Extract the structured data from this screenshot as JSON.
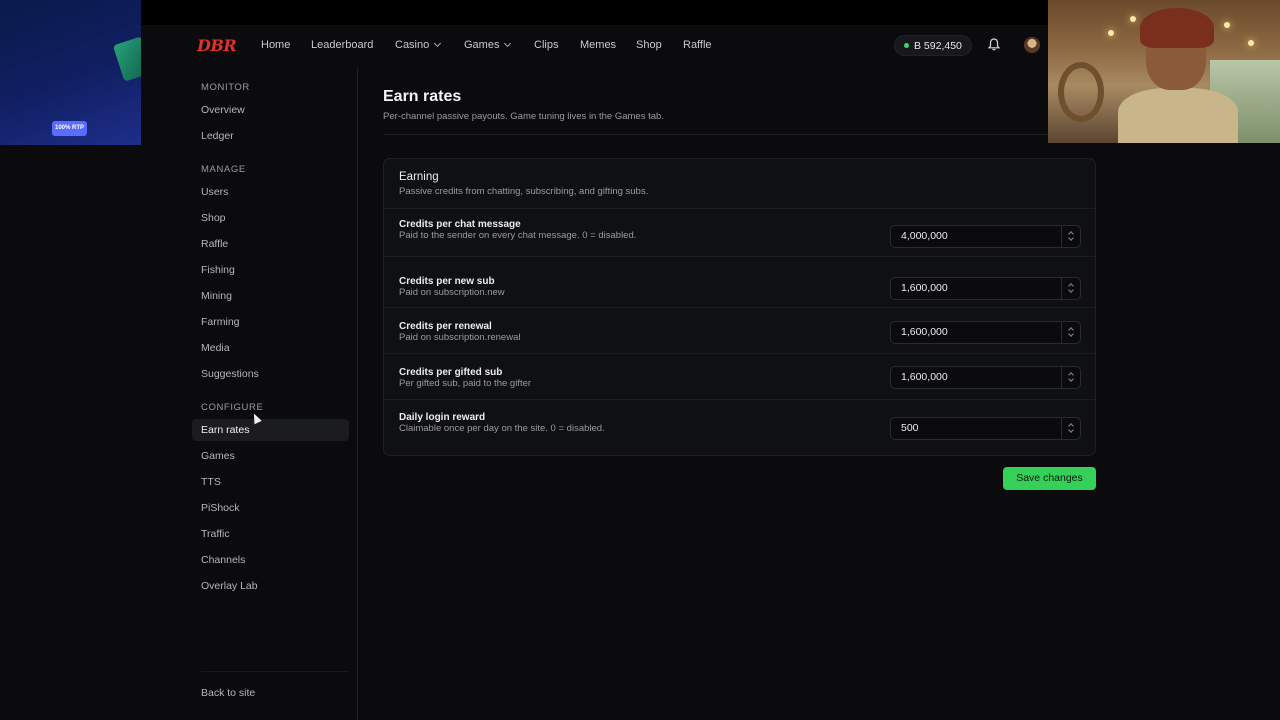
{
  "promo": {
    "badge": "100% RTP"
  },
  "nav": {
    "logo": "DBR",
    "items": [
      {
        "label": "Home"
      },
      {
        "label": "Leaderboard"
      },
      {
        "label": "Casino"
      },
      {
        "label": "Games"
      },
      {
        "label": "Clips"
      },
      {
        "label": "Memes"
      },
      {
        "label": "Shop"
      },
      {
        "label": "Raffle"
      }
    ],
    "balance": "B 592,450",
    "accent": "#e0312b"
  },
  "sidebar": {
    "monitor_label": "MONITOR",
    "monitor": [
      {
        "label": "Overview"
      },
      {
        "label": "Ledger"
      }
    ],
    "manage_label": "MANAGE",
    "manage": [
      {
        "label": "Users"
      },
      {
        "label": "Shop"
      },
      {
        "label": "Raffle"
      },
      {
        "label": "Fishing"
      },
      {
        "label": "Mining"
      },
      {
        "label": "Farming"
      },
      {
        "label": "Media"
      },
      {
        "label": "Suggestions"
      }
    ],
    "configure_label": "CONFIGURE",
    "configure": [
      {
        "label": "Earn rates"
      },
      {
        "label": "Games"
      },
      {
        "label": "TTS"
      },
      {
        "label": "PiShock"
      },
      {
        "label": "Traffic"
      },
      {
        "label": "Channels"
      },
      {
        "label": "Overlay Lab"
      }
    ],
    "active": "Earn rates",
    "back": "Back to site"
  },
  "main": {
    "title": "Earn rates",
    "subtitle": "Per-channel passive payouts. Game tuning lives in the Games tab.",
    "card": {
      "title": "Earning",
      "subtitle": "Passive credits from chatting, subscribing, and gifting subs.",
      "rows": [
        {
          "label": "Credits per chat message",
          "desc": "Paid to the sender on every chat message. 0 = disabled.",
          "value": "4,000,000"
        },
        {
          "label": "Credits per new sub",
          "desc": "Paid on subscription.new",
          "value": "1,600,000"
        },
        {
          "label": "Credits per renewal",
          "desc": "Paid on subscription.renewal",
          "value": "1,600,000"
        },
        {
          "label": "Credits per gifted sub",
          "desc": "Per gifted sub, paid to the gifter",
          "value": "1,600,000"
        },
        {
          "label": "Daily login reward",
          "desc": "Claimable once per day on the site. 0 = disabled.",
          "value": "500"
        }
      ]
    },
    "save_label": "Save changes",
    "save_color": "#34d058"
  }
}
